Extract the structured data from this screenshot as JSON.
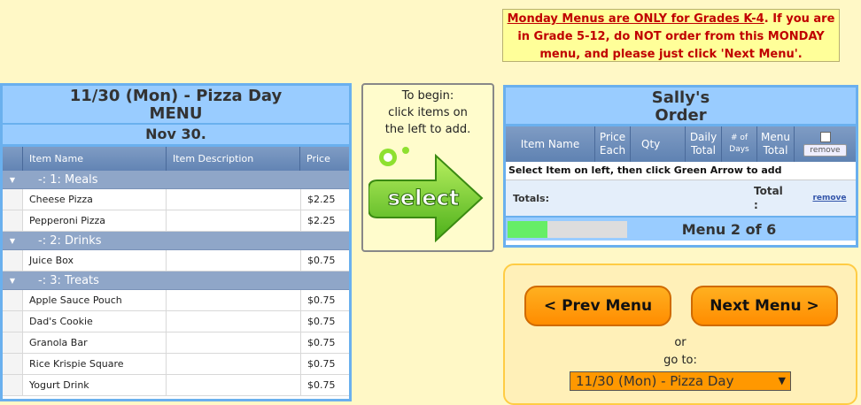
{
  "notice": {
    "underlined": "Monday Menus are ONLY for Grades K-4",
    "rest_line1": ". If you are",
    "line2": "in Grade 5-12, do NOT order from this MONDAY",
    "line3": "menu, and please just click 'Next Menu'."
  },
  "menu": {
    "title_line1": "11/30 (Mon) - Pizza Day",
    "title_line2": "MENU",
    "date": "Nov 30.",
    "columns": {
      "name": "Item Name",
      "description": "Item Description",
      "price": "Price"
    },
    "groups": [
      {
        "label": "-: 1: Meals",
        "items": [
          {
            "name": "Cheese Pizza",
            "description": "",
            "price": "$2.25"
          },
          {
            "name": "Pepperoni Pizza",
            "description": "",
            "price": "$2.25"
          }
        ]
      },
      {
        "label": "-: 2: Drinks",
        "items": [
          {
            "name": "Juice Box",
            "description": "",
            "price": "$0.75"
          }
        ]
      },
      {
        "label": "-: 3: Treats",
        "items": [
          {
            "name": "Apple Sauce Pouch",
            "description": "",
            "price": "$0.75"
          },
          {
            "name": "Dad's Cookie",
            "description": "",
            "price": "$0.75"
          },
          {
            "name": "Granola Bar",
            "description": "",
            "price": "$0.75"
          },
          {
            "name": "Rice Krispie Square",
            "description": "",
            "price": "$0.75"
          },
          {
            "name": "Yogurt Drink",
            "description": "",
            "price": "$0.75"
          }
        ]
      }
    ]
  },
  "begin": {
    "line1": "To begin:",
    "line2": "click items on",
    "line3": "the left to add.",
    "select_label": "select"
  },
  "order": {
    "title_line1": "Sally's",
    "title_line2": "Order",
    "columns": {
      "name": "Item Name",
      "price_line1": "Price",
      "price_line2": "Each",
      "qty": "Qty",
      "daily_line1": "Daily",
      "daily_line2": "Total",
      "days_line1": "# of",
      "days_line2": "Days",
      "menu_total_line1": "Menu",
      "menu_total_line2": "Total",
      "remove_button": "remove"
    },
    "hint": "Select Item on left, then click Green Arrow to add",
    "totals_label": "Totals:",
    "total_line1": "Total",
    "total_line2": ":",
    "remove_link": "remove",
    "progress_fraction": 0.3333,
    "menu_count": "Menu 2 of 6"
  },
  "nav": {
    "prev_label": "< Prev Menu",
    "next_label": "Next Menu >",
    "or_text": "or",
    "goto_text": "go to:",
    "selected_menu": "11/30 (Mon) - Pizza Day"
  },
  "colors": {
    "page_bg": "#fff8c6",
    "panel_blue": "#99ccff",
    "header_blue": "#6284b4",
    "notice_red": "#c00000",
    "button_orange": "#ff8c00",
    "select_green": "#7ed321",
    "progress_green": "#66ee66"
  }
}
